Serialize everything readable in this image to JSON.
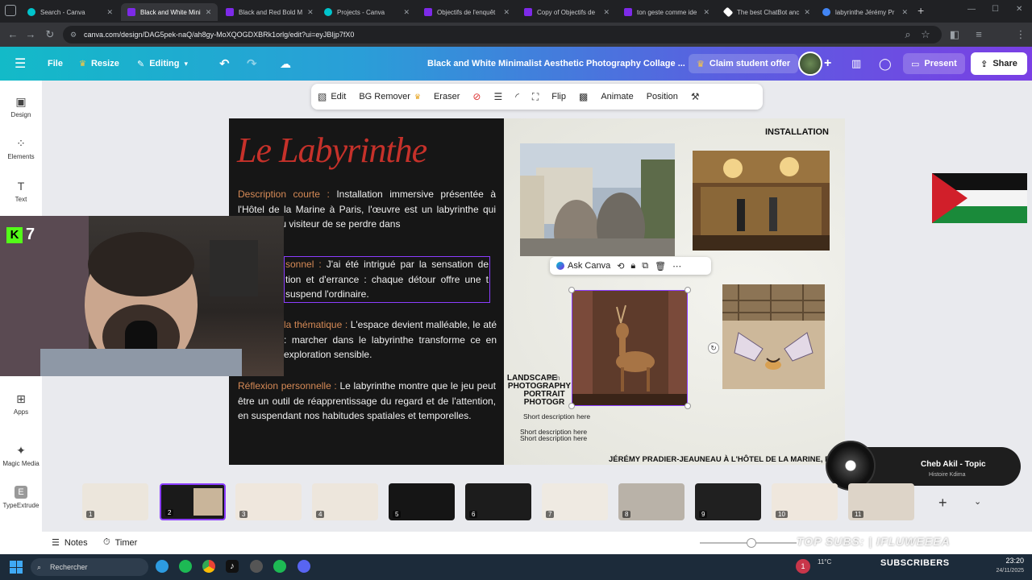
{
  "browser": {
    "tabs": [
      {
        "title": "Search - Canva",
        "color": "#00c4cc"
      },
      {
        "title": "Black and White Mini",
        "color": "#7d2ae8",
        "active": true
      },
      {
        "title": "Black and Red Bold M",
        "color": "#7d2ae8"
      },
      {
        "title": "Projects - Canva",
        "color": "#00c4cc"
      },
      {
        "title": "Objectifs de l'enquêt",
        "color": "#7d2ae8"
      },
      {
        "title": "Copy of Objectifs de",
        "color": "#7d2ae8"
      },
      {
        "title": "ton geste comme ide",
        "color": "#7d2ae8"
      },
      {
        "title": "The best ChatBot anc",
        "color": "#ffffff"
      },
      {
        "title": "labyrinthe Jérémy Pr",
        "color": "#4285f4"
      }
    ],
    "url": "canva.com/design/DAG5pek-naQ/ah8gy-MoXQOGDXBRk1orlg/edit?ui=eyJBIjp7fX0"
  },
  "header": {
    "file": "File",
    "resize": "Resize",
    "editing": "Editing",
    "doc_title": "Black and White Minimalist Aesthetic Photography Collage ...",
    "claim": "Claim student offer",
    "present": "Present",
    "share": "Share"
  },
  "sidebar": {
    "items": [
      {
        "label": "Design"
      },
      {
        "label": "Elements"
      },
      {
        "label": "Text"
      },
      {
        "label": "Apps"
      },
      {
        "label": "Magic Media"
      },
      {
        "label": "TypeExtrude"
      }
    ]
  },
  "toolbar": {
    "edit": "Edit",
    "bg_remover": "BG Remover",
    "eraser": "Eraser",
    "flip": "Flip",
    "animate": "Animate",
    "position": "Position"
  },
  "page": {
    "title": "Le Labyrinthe",
    "paragraphs": [
      {
        "label": "Description courte :",
        "text": " Installation immersive présentée à l'Hôtel de la Marine à Paris, l'œuvre est un labyrinthe qui propose au visiteur de se perdre dans"
      },
      {
        "label": "sonnel :",
        "text": " J'ai été intrigué par la sensation de tion et d'errance : chaque détour offre une t suspend l'ordinaire."
      },
      {
        "label": "la thématique :",
        "text": " L'espace devient malléable, le até : marcher dans le labyrinthe transforme ce en exploration sensible."
      },
      {
        "label": "Réflexion personnelle :",
        "text": " Le labyrinthe montre que le jeu peut être un outil de réapprentissage du regard et de l'attention, en suspendant nos habitudes spatiales et temporelles."
      }
    ],
    "installation": "INSTALLATION",
    "caption_big": [
      "LANDSCAPE",
      "PHOTOGRAPHY",
      "PORTRAIT",
      "PHOTOGR"
    ],
    "short_desc": "Short description here",
    "short_desc_hidden": "on h",
    "credit": "JÉRÉMY PRADIER-JEAUNEAU À L'HÔTEL DE LA MARINE, P"
  },
  "ask_canva": "Ask Canva",
  "music": {
    "title": "Cheb Akil - Topic",
    "subtitle": "Histoire Kdima"
  },
  "webcam": {
    "badge": "7"
  },
  "thumbnails": [
    "1",
    "2",
    "3",
    "4",
    "5",
    "6",
    "7",
    "8",
    "9",
    "10",
    "11"
  ],
  "footer": {
    "notes": "Notes",
    "timer": "Timer",
    "overlay": "TOP SUBS: | IFLUWEEEA"
  },
  "taskbar": {
    "search": "Rechercher",
    "weather": "11°C",
    "subscribers": "SUBSCRIBERS",
    "time": "23:20",
    "date": "24/11/2025",
    "badge": "1"
  }
}
